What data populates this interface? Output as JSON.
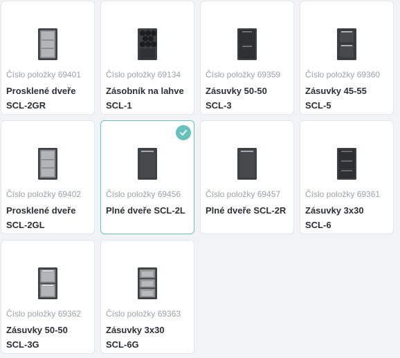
{
  "products": [
    {
      "sku": "Číslo položky 69401",
      "name": "Prosklené dveře SCL-2GR",
      "icon": "glass-door-cabinet-icon",
      "selected": false
    },
    {
      "sku": "Číslo položky 69134",
      "name": "Zásobník na lahve SCL-1",
      "icon": "bottle-rack-cabinet-icon",
      "selected": false
    },
    {
      "sku": "Číslo položky 69359",
      "name": "Zásuvky 50-50 SCL-3",
      "icon": "two-drawer-cabinet-icon",
      "selected": false
    },
    {
      "sku": "Číslo položky 69360",
      "name": "Zásuvky 45-55 SCL-5",
      "icon": "two-drawer-cabinet-icon",
      "selected": false
    },
    {
      "sku": "Číslo položky 69402",
      "name": "Prosklené dveře SCL-2GL",
      "icon": "glass-door-cabinet-icon",
      "selected": false
    },
    {
      "sku": "Číslo položky 69456",
      "name": "Plné dveře SCL-2L",
      "icon": "solid-door-cabinet-icon",
      "selected": true
    },
    {
      "sku": "Číslo položky 69457",
      "name": "Plné dveře SCL-2R",
      "icon": "solid-door-cabinet-icon",
      "selected": false
    },
    {
      "sku": "Číslo položky 69361",
      "name": "Zásuvky 3x30 SCL-6",
      "icon": "three-drawer-cabinet-icon",
      "selected": false
    },
    {
      "sku": "Číslo položky 69362",
      "name": "Zásuvky 50-50 SCL-3G",
      "icon": "two-glass-drawer-cabinet-icon",
      "selected": false
    },
    {
      "sku": "Číslo položky 69363",
      "name": "Zásuvky 3x30 SCL-6G",
      "icon": "three-glass-drawer-cabinet-icon",
      "selected": false
    }
  ],
  "colors": {
    "accent": "#67c2bd",
    "cabinet": "#3d4042",
    "text_primary": "#2c2f33",
    "text_secondary": "#9aa1a8"
  }
}
